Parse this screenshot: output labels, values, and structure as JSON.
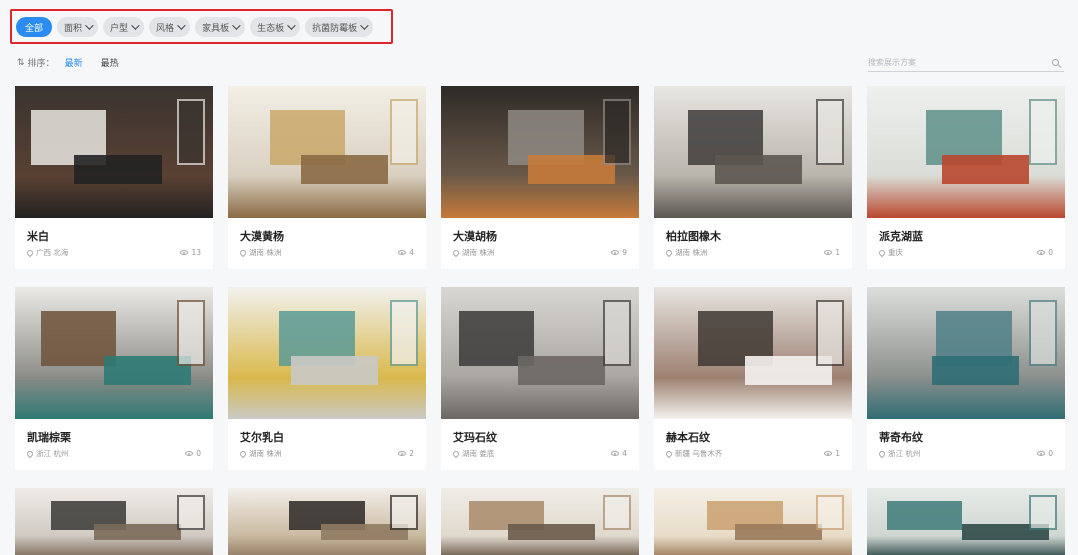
{
  "filters": {
    "all": "全部",
    "items": [
      "面积",
      "户型",
      "风格",
      "家具板",
      "生态板",
      "抗菌防霉板"
    ]
  },
  "sort": {
    "label": "排序：",
    "options": [
      "最新",
      "最热"
    ]
  },
  "search": {
    "placeholder": "搜索展示方案"
  },
  "cards": [
    {
      "title": "米白",
      "location": "广西 北海",
      "views": "13",
      "palette": [
        "#3a3430",
        "#e9e6e1",
        "#5a4133",
        "#222"
      ]
    },
    {
      "title": "大漠黄杨",
      "location": "湖南 株洲",
      "views": "4",
      "palette": [
        "#f3efe6",
        "#c9a86a",
        "#d8cfbf",
        "#8a6a44"
      ]
    },
    {
      "title": "大漠胡杨",
      "location": "湖南 株洲",
      "views": "9",
      "palette": [
        "#2e2a27",
        "#8f8a84",
        "#6b5a4a",
        "#c57a3a"
      ]
    },
    {
      "title": "柏拉图橡木",
      "location": "湖南 株洲",
      "views": "1",
      "palette": [
        "#e8e6e2",
        "#3d3b3a",
        "#b8b3ab",
        "#5c5650"
      ]
    },
    {
      "title": "派克湖蓝",
      "location": "重庆",
      "views": "0",
      "palette": [
        "#eef0ee",
        "#5e8f88",
        "#d9dcd6",
        "#b9472e"
      ]
    },
    {
      "title": "凯瑞棕栗",
      "location": "浙江 杭州",
      "views": "0",
      "palette": [
        "#eceae6",
        "#6e5138",
        "#8a8a86",
        "#2f7a74"
      ]
    },
    {
      "title": "艾尔乳白",
      "location": "湖南 株洲",
      "views": "2",
      "palette": [
        "#f1f1ef",
        "#5b9a96",
        "#d9b84a",
        "#c9c9c5"
      ]
    },
    {
      "title": "艾玛石纹",
      "location": "湖南 娄底",
      "views": "4",
      "palette": [
        "#d9d7d3",
        "#3b3a38",
        "#a9a5a0",
        "#6b6763"
      ]
    },
    {
      "title": "赫本石纹",
      "location": "新疆 乌鲁木齐",
      "views": "1",
      "palette": [
        "#e8e5e1",
        "#3f3833",
        "#9b7f6f",
        "#f4f2ef"
      ]
    },
    {
      "title": "蒂奇布纹",
      "location": "浙江 杭州",
      "views": "0",
      "palette": [
        "#dcdedb",
        "#4e7f86",
        "#8b8f8c",
        "#2f6d74"
      ]
    },
    {
      "title": "",
      "location": "",
      "views": "",
      "palette": [
        "#efece8",
        "#3a3836",
        "#cfc9c1",
        "#7a6a5a"
      ]
    },
    {
      "title": "",
      "location": "",
      "views": "",
      "palette": [
        "#f2efea",
        "#2b2826",
        "#c9b89f",
        "#8f7a62"
      ]
    },
    {
      "title": "",
      "location": "",
      "views": "",
      "palette": [
        "#f0ede8",
        "#a88a6a",
        "#e0d8cc",
        "#6a5a4a"
      ]
    },
    {
      "title": "",
      "location": "",
      "views": "",
      "palette": [
        "#f4efe5",
        "#c9a070",
        "#e8dcc8",
        "#9a7a5a"
      ]
    },
    {
      "title": "",
      "location": "",
      "views": "",
      "palette": [
        "#e6ebe8",
        "#3e7a78",
        "#cfd6d2",
        "#2e4a48"
      ]
    }
  ]
}
